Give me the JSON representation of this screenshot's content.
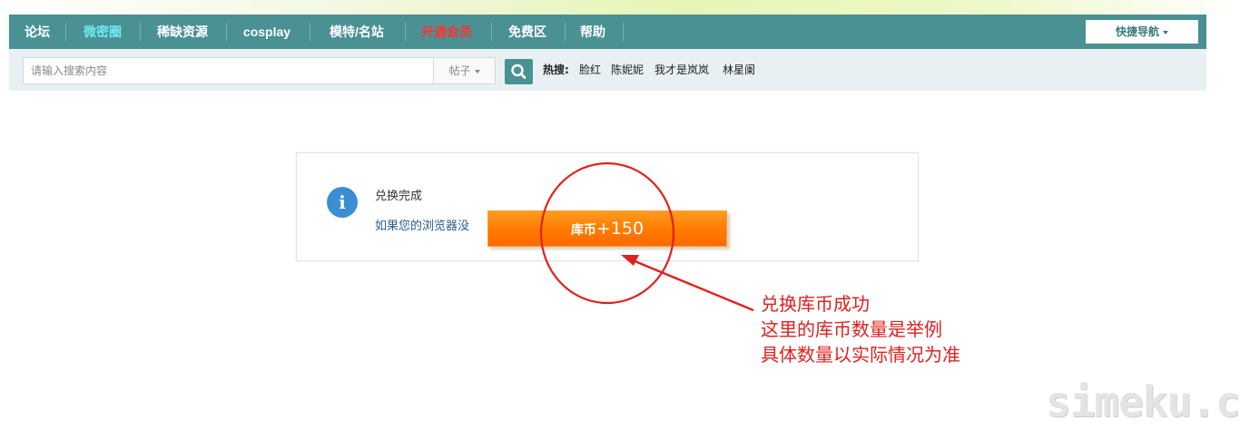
{
  "nav": {
    "items": [
      {
        "label": "论坛",
        "color": "#ffffff"
      },
      {
        "label": "微密圈",
        "color": "#6fe9f6"
      },
      {
        "label": "稀缺资源",
        "color": "#ffffff"
      },
      {
        "label": "cosplay",
        "color": "#ffffff"
      },
      {
        "label": "模特/名站",
        "color": "#ffffff"
      },
      {
        "label": "开通会员",
        "color": "#ff3333"
      },
      {
        "label": "免费区",
        "color": "#ffffff"
      },
      {
        "label": "帮助",
        "color": "#ffffff"
      }
    ],
    "quick_nav_label": "快捷导航"
  },
  "search": {
    "placeholder": "请输入搜索内容",
    "type_label": "帖子",
    "hot_label": "热搜:",
    "hot_items": [
      "脸红",
      "陈妮妮",
      "我才是岚岚",
      "林星阑"
    ]
  },
  "message": {
    "title": "兑换完成",
    "link_text": "如果您的浏览器没"
  },
  "coin_popup": {
    "label": "库币",
    "amount": "+150"
  },
  "annotation": {
    "lines": [
      "兑换库币成功",
      "这里的库币数量是举例",
      "具体数量以实际情况为准"
    ],
    "color": "#e02020"
  },
  "watermark": "simeku.cn",
  "colors": {
    "nav_bg": "#4a9193",
    "search_bg": "#e9f0f4",
    "coin_orange": "#ff7a00",
    "info_blue": "#3a8ed1"
  }
}
